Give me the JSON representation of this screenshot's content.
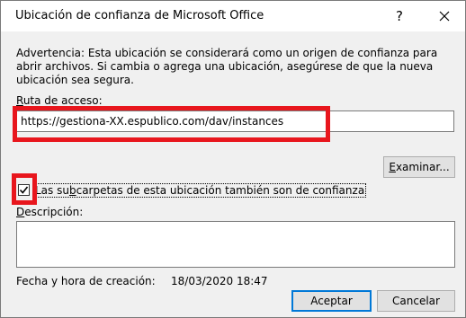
{
  "dialog": {
    "title": "Ubicación de confianza de Microsoft Office",
    "help_label": "?",
    "warning_text": "Advertencia: Esta ubicación se considerará como un origen de confianza para abrir archivos. Si cambia o agrega una ubicación, asegúrese de que la nueva ubicación sea segura.",
    "path_label": "Ruta de acceso:",
    "path_value": "https://gestiona-XX.espublico.com/dav/instances",
    "browse_label": "Examinar...",
    "subfolders": {
      "checked": true,
      "label": "Las subcarpetas de esta ubicación también son de confianza"
    },
    "description_label": "Descripción:",
    "description_value": "",
    "created_label": "Fecha y hora de creación:",
    "created_value": "18/03/2020 18:47",
    "ok_label": "Aceptar",
    "cancel_label": "Cancelar"
  },
  "colors": {
    "highlight_red": "#e8161d",
    "default_button_border": "#0078d7"
  }
}
